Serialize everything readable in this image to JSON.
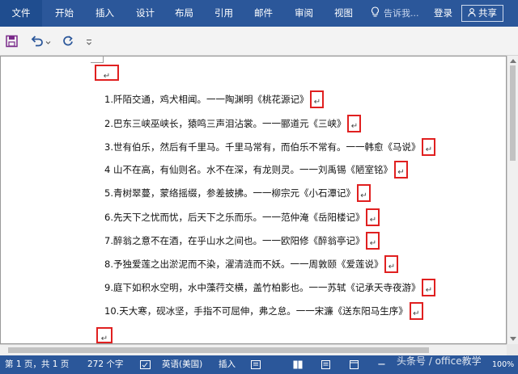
{
  "ribbon": {
    "tabs": [
      "文件",
      "开始",
      "插入",
      "设计",
      "布局",
      "引用",
      "邮件",
      "审阅",
      "视图"
    ],
    "search_placeholder": "告诉我...",
    "login": "登录",
    "share": "共享"
  },
  "document": {
    "lines": [
      "1.阡陌交通，鸡犬相闻。一一陶渊明《桃花源记》",
      "2.巴东三峡巫峡长，猿鸣三声泪沾裳。一一郦道元《三峡》",
      "3.世有伯乐，然后有千里马。千里马常有，而伯乐不常有。一一韩愈《马说》",
      "4 山不在高，有仙则名。水不在深，有龙则灵。一一刘禹锡《陋室铭》",
      "5.青树翠蔓，蒙络摇缀，参差披拂。一一柳宗元《小石潭记》",
      "6.先天下之忧而忧，后天下之乐而乐。一一范仲淹《岳阳楼记》",
      "7.醉翁之意不在酒，在乎山水之间也。一一欧阳修《醉翁亭记》",
      "8.予独爱莲之出淤泥而不染，濯清涟而不妖。一一周敦颐《爱莲说》",
      "9.庭下如积水空明，水中藻荇交横，盖竹柏影也。一一苏轼《记承天寺夜游》",
      "10.天大寒，砚冰坚，手指不可屈伸，弗之怠。一一宋濂《送东阳马生序》"
    ],
    "paragraph_mark": "↵"
  },
  "status": {
    "page": "第 1 页，共 1 页",
    "words": "272 个字",
    "language": "英语(美国)",
    "mode": "插入",
    "zoom": "100%"
  },
  "watermark": "头条号 / office教学",
  "colors": {
    "accent": "#2b579a",
    "highlight": "#e02020"
  }
}
